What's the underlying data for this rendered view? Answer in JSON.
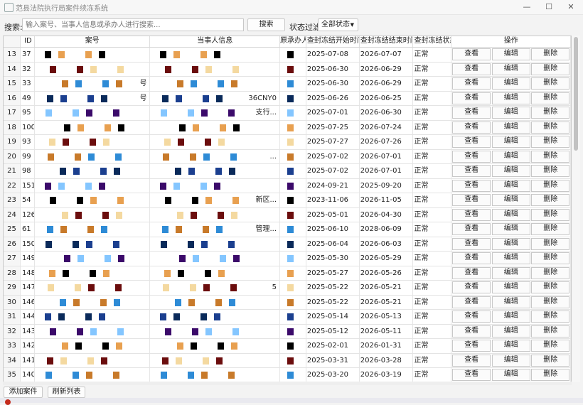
{
  "window": {
    "title": "范县法院执行局案件续冻系统",
    "min_glyph": "—",
    "max_glyph": "☐",
    "close_glyph": "✕"
  },
  "toolbar": {
    "search_label": "搜索:",
    "search_placeholder": "输入案号、当事人信息或承办人进行搜索...",
    "search_button": "搜索",
    "filter_label": "状态过滤:",
    "filter_value": "全部状态"
  },
  "table": {
    "headers": [
      "",
      "ID",
      "案号",
      "当事人信息",
      "原承办人",
      "查封冻结开始时间",
      "查封冻结结束时间",
      "查封冻结状态",
      "操作"
    ],
    "rows": [
      {
        "rn": "13",
        "id": "37",
        "case": "",
        "party": "",
        "handler": "",
        "start": "2025-07-08",
        "end": "2026-07-07",
        "status": "正常"
      },
      {
        "rn": "14",
        "id": "32",
        "case": "",
        "party": "",
        "handler": "",
        "start": "2025-06-30",
        "end": "2026-06-29",
        "status": "正常"
      },
      {
        "rn": "15",
        "id": "33",
        "case": "号",
        "party": "",
        "handler": "",
        "start": "2025-06-30",
        "end": "2026-06-29",
        "status": "正常"
      },
      {
        "rn": "16",
        "id": "49",
        "case": "号",
        "party": "36CNY0",
        "handler": "",
        "start": "2025-06-26",
        "end": "2026-06-25",
        "status": "正常"
      },
      {
        "rn": "17",
        "id": "95",
        "case": "",
        "party": "支行...",
        "handler": "",
        "start": "2025-07-01",
        "end": "2026-06-30",
        "status": "正常"
      },
      {
        "rn": "18",
        "id": "100",
        "case": "",
        "party": "",
        "handler": "",
        "start": "2025-07-25",
        "end": "2026-07-24",
        "status": "正常"
      },
      {
        "rn": "19",
        "id": "93",
        "case": "",
        "party": "",
        "handler": "",
        "start": "2025-07-27",
        "end": "2026-07-26",
        "status": "正常"
      },
      {
        "rn": "20",
        "id": "99",
        "case": "",
        "party": "...",
        "handler": "",
        "start": "2025-07-02",
        "end": "2026-07-01",
        "status": "正常"
      },
      {
        "rn": "21",
        "id": "98",
        "case": "",
        "party": "",
        "handler": "",
        "start": "2025-07-02",
        "end": "2026-07-01",
        "status": "正常"
      },
      {
        "rn": "22",
        "id": "151",
        "case": "",
        "party": "",
        "handler": "",
        "start": "2024-09-21",
        "end": "2025-09-20",
        "status": "正常"
      },
      {
        "rn": "23",
        "id": "54",
        "case": "",
        "party": "新区...",
        "handler": "",
        "start": "2023-11-06",
        "end": "2026-11-05",
        "status": "正常"
      },
      {
        "rn": "24",
        "id": "126",
        "case": "",
        "party": "",
        "handler": "",
        "start": "2025-05-01",
        "end": "2026-04-30",
        "status": "正常"
      },
      {
        "rn": "25",
        "id": "61",
        "case": "",
        "party": "管理...",
        "handler": "",
        "start": "2025-06-10",
        "end": "2028-06-09",
        "status": "正常"
      },
      {
        "rn": "26",
        "id": "150",
        "case": "",
        "party": "",
        "handler": "",
        "start": "2025-06-04",
        "end": "2026-06-03",
        "status": "正常"
      },
      {
        "rn": "27",
        "id": "149",
        "case": "",
        "party": "",
        "handler": "",
        "start": "2025-05-30",
        "end": "2026-05-29",
        "status": "正常"
      },
      {
        "rn": "28",
        "id": "148",
        "case": "",
        "party": "",
        "handler": "",
        "start": "2025-05-27",
        "end": "2026-05-26",
        "status": "正常"
      },
      {
        "rn": "29",
        "id": "147",
        "case": "",
        "party": "5",
        "handler": "",
        "start": "2025-05-22",
        "end": "2026-05-21",
        "status": "正常"
      },
      {
        "rn": "30",
        "id": "146",
        "case": "",
        "party": "",
        "handler": "",
        "start": "2025-05-22",
        "end": "2026-05-21",
        "status": "正常"
      },
      {
        "rn": "31",
        "id": "144",
        "case": "",
        "party": "",
        "handler": "",
        "start": "2025-05-14",
        "end": "2026-05-13",
        "status": "正常"
      },
      {
        "rn": "32",
        "id": "143",
        "case": "",
        "party": "",
        "handler": "",
        "start": "2025-05-12",
        "end": "2026-05-11",
        "status": "正常"
      },
      {
        "rn": "33",
        "id": "142",
        "case": "",
        "party": "",
        "handler": "",
        "start": "2025-02-01",
        "end": "2026-01-31",
        "status": "正常"
      },
      {
        "rn": "34",
        "id": "141",
        "case": "",
        "party": "",
        "handler": "",
        "start": "2025-03-31",
        "end": "2026-03-28",
        "status": "正常"
      },
      {
        "rn": "35",
        "id": "140",
        "case": "",
        "party": "",
        "handler": "",
        "start": "2025-03-20",
        "end": "2026-03-19",
        "status": "正常"
      }
    ],
    "op_view": "查看",
    "op_edit": "编辑",
    "op_delete": "删除"
  },
  "footer": {
    "add_button": "添加案件",
    "refresh_button": "刷新列表"
  },
  "colors": {
    "redaction": [
      "#000000",
      "#c87a2a",
      "#84c6ff",
      "#6b0d0d",
      "#1b3f8f",
      "#e8a050",
      "#2e8bd6",
      "#3b0a6a",
      "#f4d9a0",
      "#0a2a5a"
    ]
  }
}
